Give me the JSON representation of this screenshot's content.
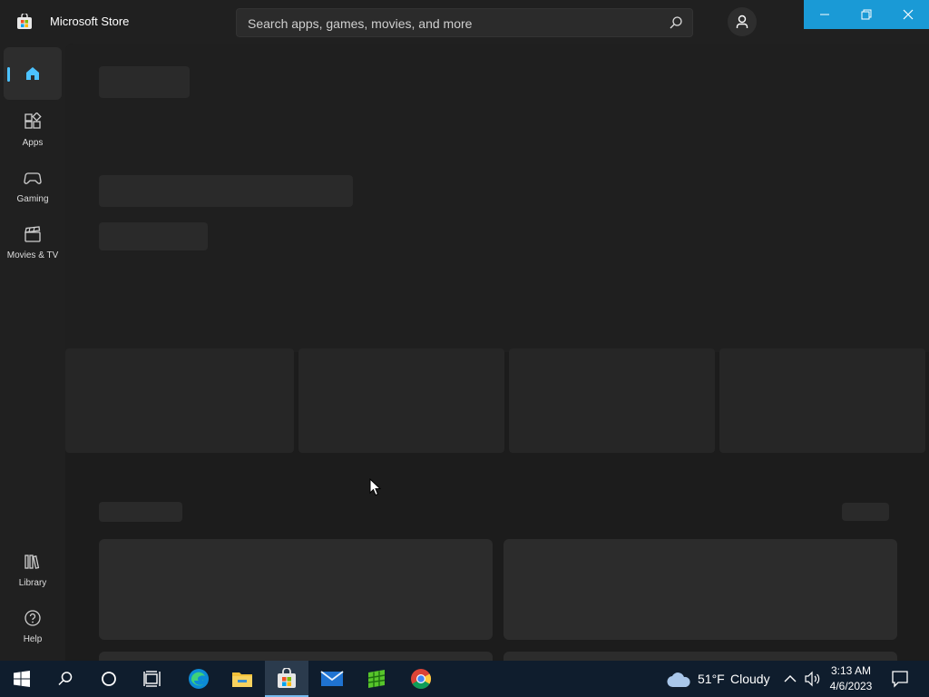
{
  "app": {
    "title": "Microsoft Store"
  },
  "search": {
    "placeholder": "Search apps, games, movies, and more"
  },
  "sidebar": {
    "items": [
      {
        "label": "",
        "icon": "home-icon",
        "active": true
      },
      {
        "label": "Apps",
        "icon": "apps-icon"
      },
      {
        "label": "Gaming",
        "icon": "gamepad-icon"
      },
      {
        "label": "Movies & TV",
        "icon": "clapperboard-icon"
      },
      {
        "label": "Library",
        "icon": "library-icon"
      },
      {
        "label": "Help",
        "icon": "help-icon"
      }
    ]
  },
  "colors": {
    "accent": "#4cc2ff",
    "titlebar_controls": "#1a9ad6",
    "taskbar": "#0f1d2d"
  },
  "taskbar": {
    "weather": {
      "temp": "51°F",
      "condition": "Cloudy"
    },
    "clock": {
      "time": "3:13 AM",
      "date": "4/6/2023"
    }
  }
}
